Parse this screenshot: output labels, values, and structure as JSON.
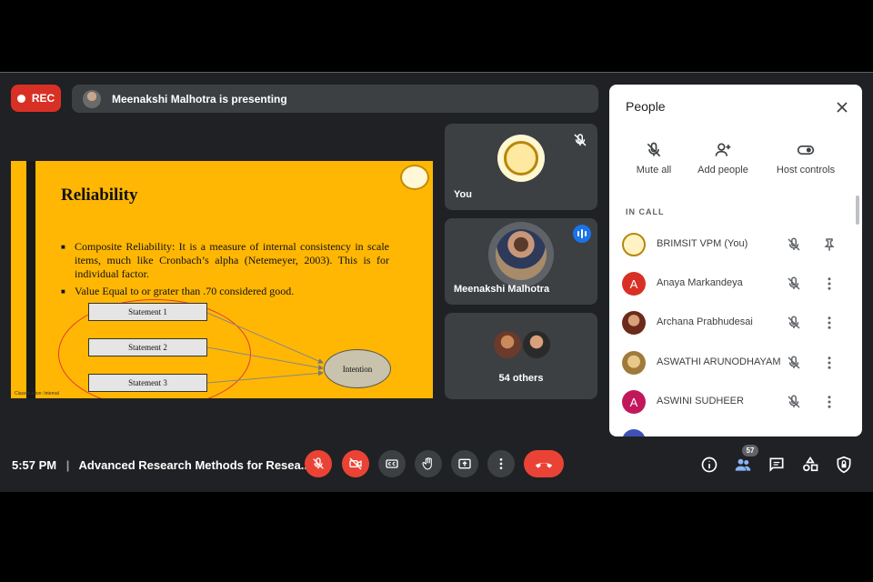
{
  "recording": {
    "label": "REC"
  },
  "presenter_banner": {
    "text": "Meenakshi Malhotra is presenting"
  },
  "slide": {
    "title": "Reliability",
    "bullets": [
      "Composite Reliability: It is a measure of internal consistency in scale items, much like Cronbach’s alpha (Netemeyer, 2003). This is for individual factor.",
      "Value Equal to or grater than .70 considered good."
    ],
    "statements": [
      "Statement 1",
      "Statement 2",
      "Statement 3"
    ],
    "target": "Intention",
    "footnote": "Classification: Internal"
  },
  "tiles": {
    "you": {
      "name": "You"
    },
    "presenter": {
      "name": "Meenakshi Malhotra"
    },
    "others": {
      "label": "54 others"
    }
  },
  "people_panel": {
    "title": "People",
    "actions": [
      "Mute all",
      "Add people",
      "Host controls"
    ],
    "section_label": "IN CALL",
    "participants": [
      {
        "name": "BRIMSIT VPM (You)",
        "avatar_type": "logo",
        "avatar_color": "#fff3c4"
      },
      {
        "name": "Anaya Markandeya",
        "initial": "A",
        "avatar_color": "#d93025"
      },
      {
        "name": "Archana Prabhudesai",
        "avatar_type": "photo",
        "avatar_color": "#8a4b2a"
      },
      {
        "name": "ASWATHI ARUNODHAYAM",
        "avatar_type": "photo",
        "avatar_color": "#c9a66b"
      },
      {
        "name": "ASWINI SUDHEER",
        "initial": "A",
        "avatar_color": "#c2185b"
      }
    ]
  },
  "bottom_bar": {
    "time": "5:57 PM",
    "separator": "|",
    "meeting_title": "Advanced Research Methods for Resea...",
    "people_count": "57"
  },
  "colors": {
    "background": "#202124",
    "tile": "#3c4043",
    "danger": "#ea4335",
    "accent": "#1a73e8",
    "slide_bg": "#ffb703"
  },
  "icons": [
    "mic-off-icon",
    "camera-off-icon",
    "captions-icon",
    "raise-hand-icon",
    "present-icon",
    "more-vert-icon",
    "hangup-icon",
    "info-icon",
    "people-icon",
    "chat-icon",
    "activities-icon",
    "host-controls-icon",
    "close-icon",
    "pin-icon",
    "add-person-icon",
    "toggle-icon"
  ]
}
